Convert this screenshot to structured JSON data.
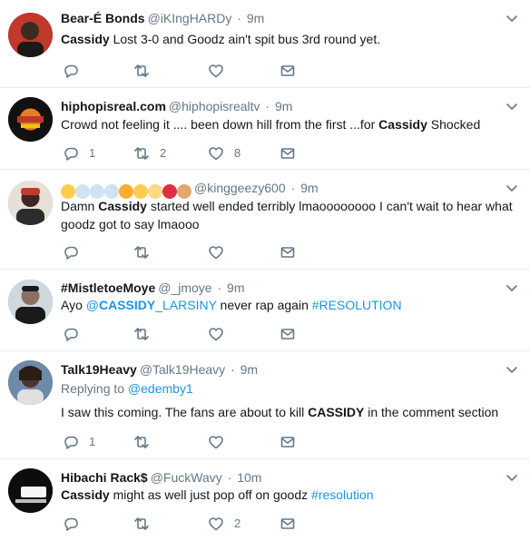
{
  "tweets": [
    {
      "name": "Bear-É Bonds",
      "handle": "@iKIngHARDy",
      "dot": "·",
      "time": "9m",
      "text_parts": [
        {
          "t": "Cassidy",
          "bold": true
        },
        {
          "t": " Lost 3-0 and Goodz ain't spit bus 3rd round yet."
        }
      ],
      "counts": {
        "reply": "",
        "retweet": "",
        "like": ""
      },
      "avatar_colors": [
        "#c0392b",
        "#3b2a20"
      ]
    },
    {
      "name": "hiphopisreal.com",
      "handle": "@hiphopisrealtv",
      "dot": "·",
      "time": "9m",
      "text_parts": [
        {
          "t": "Crowd not feeling it .... been down hill from the first ...for "
        },
        {
          "t": "Cassidy",
          "bold": true
        },
        {
          "t": "    Shocked"
        }
      ],
      "counts": {
        "reply": "1",
        "retweet": "2",
        "like": "8"
      },
      "avatar_colors": [
        "#111111",
        "#e67e22"
      ]
    },
    {
      "name": "",
      "handle": "@kinggeezy600",
      "dot": "·",
      "time": "9m",
      "emoji_name_icons": [
        "kissing-face-emoji",
        "dash-emoji",
        "dash-emoji",
        "dash-emoji",
        "steam-face-emoji",
        "zany-face-emoji",
        "worried-face-emoji",
        "hundred-emoji",
        "ok-hand-emoji"
      ],
      "text_parts": [
        {
          "t": "Damn "
        },
        {
          "t": "Cassidy",
          "bold": true
        },
        {
          "t": " started well ended terribly lmaoooooooo I can't wait to hear what goodz got to say lmaooo"
        }
      ],
      "counts": {
        "reply": "",
        "retweet": "",
        "like": ""
      },
      "avatar_colors": [
        "#c0392b",
        "#2c2c2c"
      ]
    },
    {
      "name": "#MistletoeMoye",
      "handle": "@_jmoye",
      "dot": "·",
      "time": "9m",
      "text_parts": [
        {
          "t": "Ayo "
        },
        {
          "t": "@",
          "link": true
        },
        {
          "t": "CASSIDY",
          "link": true,
          "bold": true
        },
        {
          "t": "_LARSINY",
          "link": true
        },
        {
          "t": " never rap again "
        },
        {
          "t": "#RESOLUTION",
          "link": true
        }
      ],
      "counts": {
        "reply": "",
        "retweet": "",
        "like": ""
      },
      "avatar_colors": [
        "#1a1a1a",
        "#8d6e63"
      ]
    },
    {
      "name": "Talk19Heavy",
      "handle": "@Talk19Heavy",
      "dot": "·",
      "time": "9m",
      "replying_label": "Replying to ",
      "replying_to": "@edemby1",
      "text_parts": [
        {
          "t": "I saw this coming. The fans are about to kill "
        },
        {
          "t": "CASSIDY",
          "bold": true
        },
        {
          "t": " in the comment section"
        }
      ],
      "counts": {
        "reply": "1",
        "retweet": "",
        "like": ""
      },
      "avatar_colors": [
        "#6d8aa8",
        "#4e342e"
      ]
    },
    {
      "name": "Hibachi Rack$",
      "handle": "@FuckWavy",
      "dot": "·",
      "time": "10m",
      "text_parts": [
        {
          "t": "Cassidy",
          "bold": true
        },
        {
          "t": " might as well just pop off on goodz "
        },
        {
          "t": "#resolution",
          "link": true
        }
      ],
      "counts": {
        "reply": "",
        "retweet": "",
        "like": "2"
      },
      "avatar_colors": [
        "#0d0d0d",
        "#f5f5f5"
      ]
    }
  ],
  "colors": {
    "secondary_text": "#657786",
    "link": "#1b95e0",
    "divider": "#e6ecf0"
  }
}
